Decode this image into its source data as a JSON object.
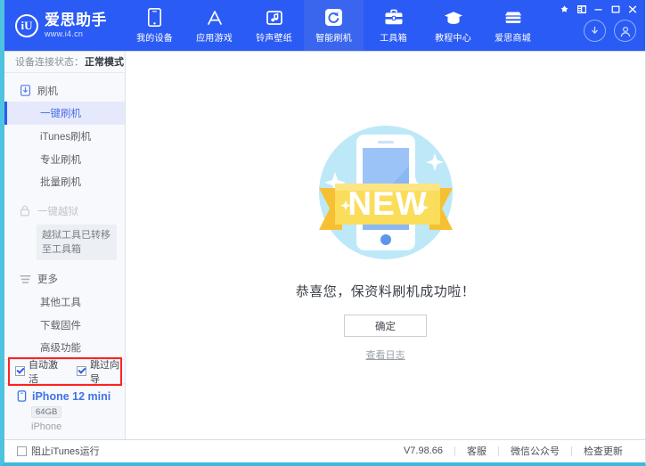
{
  "header": {
    "brand_name": "爱思助手",
    "brand_url": "www.i4.cn",
    "logo_glyph": "iU",
    "tabs": [
      {
        "label": "我的设备",
        "icon": "phone-icon",
        "active": false
      },
      {
        "label": "应用游戏",
        "icon": "appstore-icon",
        "active": false
      },
      {
        "label": "铃声壁纸",
        "icon": "ringtone-icon",
        "active": false
      },
      {
        "label": "智能刷机",
        "icon": "refresh-icon",
        "active": true
      },
      {
        "label": "工具箱",
        "icon": "toolbox-icon",
        "active": false
      },
      {
        "label": "教程中心",
        "icon": "graduation-cap-icon",
        "active": false
      },
      {
        "label": "爱思商城",
        "icon": "shop-icon",
        "active": false
      }
    ],
    "window_buttons": [
      {
        "name": "skin-icon",
        "glyph": "❖"
      },
      {
        "name": "menu-icon",
        "glyph": "▤"
      },
      {
        "name": "minimize-icon",
        "glyph": "—"
      },
      {
        "name": "maximize-icon",
        "glyph": "▢"
      },
      {
        "name": "close-icon",
        "glyph": "✕"
      }
    ],
    "download_icon": "download-circle-icon",
    "account_icon": "user-circle-icon"
  },
  "sidebar": {
    "connection_label": "设备连接状态：",
    "connection_value": "正常模式",
    "groups": [
      {
        "title": "刷机",
        "icon": "flash-device-icon",
        "dim": false,
        "items": [
          {
            "label": "一键刷机",
            "active": true
          },
          {
            "label": "iTunes刷机",
            "active": false
          },
          {
            "label": "专业刷机",
            "active": false
          },
          {
            "label": "批量刷机",
            "active": false
          }
        ]
      },
      {
        "title": "一键越狱",
        "icon": "lock-icon",
        "dim": true,
        "tooltip": "越狱工具已转移至工具箱",
        "items": []
      },
      {
        "title": "更多",
        "icon": "more-lines-icon",
        "dim": false,
        "items": [
          {
            "label": "其他工具",
            "active": false
          },
          {
            "label": "下载固件",
            "active": false
          },
          {
            "label": "高级功能",
            "active": false
          }
        ]
      }
    ],
    "options": [
      {
        "label": "自动激活",
        "checked": true
      },
      {
        "label": "跳过向导",
        "checked": true
      }
    ],
    "highlight_color": "#ff2222",
    "device": {
      "name": "iPhone 12 mini",
      "capacity": "64GB",
      "type": "iPhone",
      "icon": "phone-small-icon"
    }
  },
  "main": {
    "illustration": "new-badge-phone-illustration",
    "illustration_label": "NEW",
    "success_message": "恭喜您，保资料刷机成功啦！",
    "confirm_label": "确定",
    "log_link_label": "查看日志"
  },
  "footer": {
    "block_itunes_label": "阻止iTunes运行",
    "block_itunes_checked": false,
    "version": "V7.98.66",
    "links": [
      "客服",
      "微信公众号",
      "检查更新"
    ]
  },
  "colors": {
    "brand_blue": "#2b5bf5",
    "accent_cyan": "#4ec3e0",
    "selection_blue": "#e5e9fb",
    "highlight_red": "#ff2222"
  }
}
